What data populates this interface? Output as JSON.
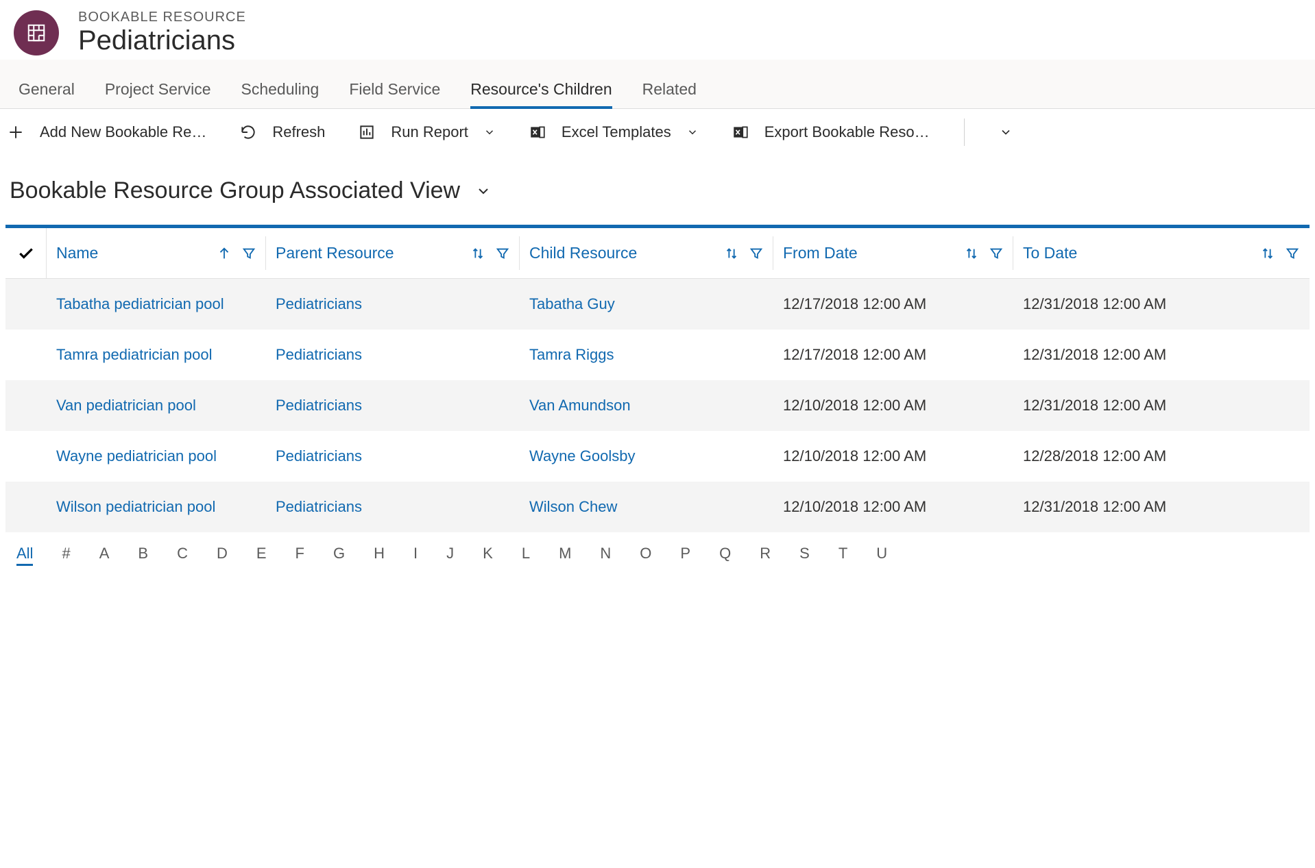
{
  "header": {
    "subtitle": "BOOKABLE RESOURCE",
    "title": "Pediatricians"
  },
  "tabs": [
    {
      "label": "General",
      "active": false
    },
    {
      "label": "Project Service",
      "active": false
    },
    {
      "label": "Scheduling",
      "active": false
    },
    {
      "label": "Field Service",
      "active": false
    },
    {
      "label": "Resource's Children",
      "active": true
    },
    {
      "label": "Related",
      "active": false
    }
  ],
  "toolbar": {
    "add": "Add New Bookable Re…",
    "refresh": "Refresh",
    "run_report": "Run Report",
    "excel_templates": "Excel Templates",
    "export": "Export Bookable Reso…"
  },
  "view": {
    "title": "Bookable Resource Group Associated View"
  },
  "grid": {
    "columns": {
      "name": "Name",
      "parent": "Parent Resource",
      "child": "Child Resource",
      "from": "From Date",
      "to": "To Date"
    },
    "rows": [
      {
        "name": "Tabatha pediatrician pool",
        "parent": "Pediatricians",
        "child": "Tabatha Guy",
        "from": "12/17/2018 12:00 AM",
        "to": "12/31/2018 12:00 AM"
      },
      {
        "name": "Tamra pediatrician pool",
        "parent": "Pediatricians",
        "child": "Tamra Riggs",
        "from": "12/17/2018 12:00 AM",
        "to": "12/31/2018 12:00 AM"
      },
      {
        "name": "Van pediatrician pool",
        "parent": "Pediatricians",
        "child": "Van Amundson",
        "from": "12/10/2018 12:00 AM",
        "to": "12/31/2018 12:00 AM"
      },
      {
        "name": "Wayne pediatrician pool",
        "parent": "Pediatricians",
        "child": "Wayne Goolsby",
        "from": "12/10/2018 12:00 AM",
        "to": "12/28/2018 12:00 AM"
      },
      {
        "name": "Wilson pediatrician pool",
        "parent": "Pediatricians",
        "child": "Wilson Chew",
        "from": "12/10/2018 12:00 AM",
        "to": "12/31/2018 12:00 AM"
      }
    ]
  },
  "alpha": {
    "items": [
      "All",
      "#",
      "A",
      "B",
      "C",
      "D",
      "E",
      "F",
      "G",
      "H",
      "I",
      "J",
      "K",
      "L",
      "M",
      "N",
      "O",
      "P",
      "Q",
      "R",
      "S",
      "T",
      "U"
    ],
    "active": "All"
  }
}
